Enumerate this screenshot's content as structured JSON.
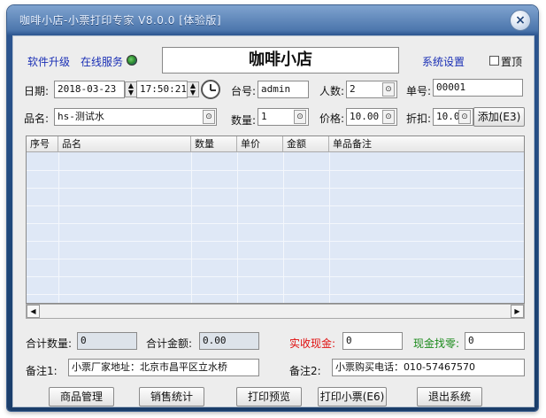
{
  "window": {
    "title": "咖啡小店-小票打印专家 V8.0.0 [体验版]",
    "close_glyph": "×"
  },
  "topbar": {
    "upgrade_link": "软件升级",
    "online_service_link": "在线服务",
    "shop_name": "咖啡小店",
    "settings_link": "系统设置",
    "pin_top_label": "置顶"
  },
  "order": {
    "date_label": "日期:",
    "date_value": "2018-03-23",
    "time_value": "17:50:21",
    "table_label": "台号:",
    "table_value": "admin",
    "people_label": "人数:",
    "people_value": "2",
    "number_label": "单号:",
    "number_value": "00001"
  },
  "item": {
    "name_label": "品名:",
    "name_value": "hs-测试水",
    "qty_label": "数量:",
    "qty_value": "1",
    "price_label": "价格:",
    "price_value": "10.00",
    "discount_label": "折扣:",
    "discount_value": "10.0",
    "add_button": "添加(E3)"
  },
  "table": {
    "columns": [
      "序号",
      "品名",
      "数量",
      "单价",
      "金额",
      "单品备注"
    ]
  },
  "totals": {
    "total_qty_label": "合计数量:",
    "total_qty_value": "0",
    "total_amount_label": "合计金额:",
    "total_amount_value": "0.00",
    "cash_received_label": "实收现金:",
    "cash_received_value": "0",
    "change_label": "现金找零:",
    "change_value": "0"
  },
  "notes": {
    "note1_label": "备注1:",
    "note1_value": "小票厂家地址：北京市昌平区立水桥",
    "note2_label": "备注2:",
    "note2_value": "小票购买电话：010-57467570"
  },
  "buttons": {
    "goods": "商品管理",
    "sales": "销售统计",
    "preview": "打印预览",
    "print": "打印小票(E6)",
    "exit": "退出系统"
  },
  "colors": {
    "cash_label": "#e01010",
    "change_label": "#1a8a1a",
    "link": "#1a2fb5"
  }
}
